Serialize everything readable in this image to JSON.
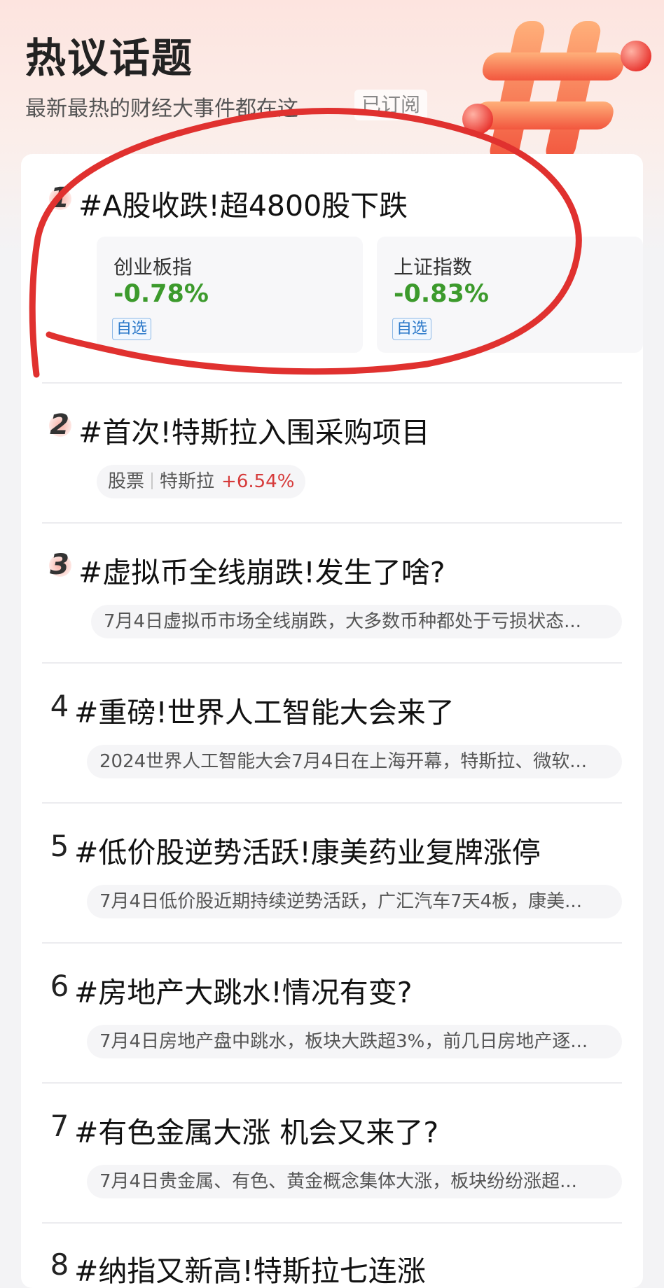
{
  "header": {
    "title": "热议话题",
    "subtitle": "最新最热的财经大事件都在这",
    "subscribe_label": "已订阅",
    "decoration_icon": "hashtag-icon"
  },
  "topics": [
    {
      "rank": "1",
      "title": "#A股收跌!超4800股下跌",
      "indices": [
        {
          "name": "创业板指",
          "change": "-0.78%",
          "action": "自选"
        },
        {
          "name": "上证指数",
          "change": "-0.83%",
          "action": "自选"
        }
      ]
    },
    {
      "rank": "2",
      "title": "#首次!特斯拉入围采购项目",
      "stock": {
        "type": "股票",
        "name": "特斯拉",
        "change": "+6.54%"
      }
    },
    {
      "rank": "3",
      "title": "#虚拟币全线崩跌!发生了啥?",
      "summary": "7月4日虚拟币市场全线崩跌，大多数币种都处于亏损状态..."
    },
    {
      "rank": "4",
      "title": "#重磅!世界人工智能大会来了",
      "summary": "2024世界人工智能大会7月4日在上海开幕，特斯拉、微软..."
    },
    {
      "rank": "5",
      "title": "#低价股逆势活跃!康美药业复牌涨停",
      "summary": "7月4日低价股近期持续逆势活跃，广汇汽车7天4板，康美..."
    },
    {
      "rank": "6",
      "title": "#房地产大跳水!情况有变?",
      "summary": "7月4日房地产盘中跳水，板块大跌超3%，前几日房地产逐..."
    },
    {
      "rank": "7",
      "title": "#有色金属大涨 机会又来了?",
      "summary": "7月4日贵金属、有色、黄金概念集体大涨，板块纷纷涨超..."
    },
    {
      "rank": "8",
      "title": "#纳指又新高!特斯拉七连涨"
    }
  ],
  "colors": {
    "down": "#3c9a2c",
    "up": "#d63a3a",
    "annotation": "#e0312f",
    "accent": "#f05a3c"
  }
}
